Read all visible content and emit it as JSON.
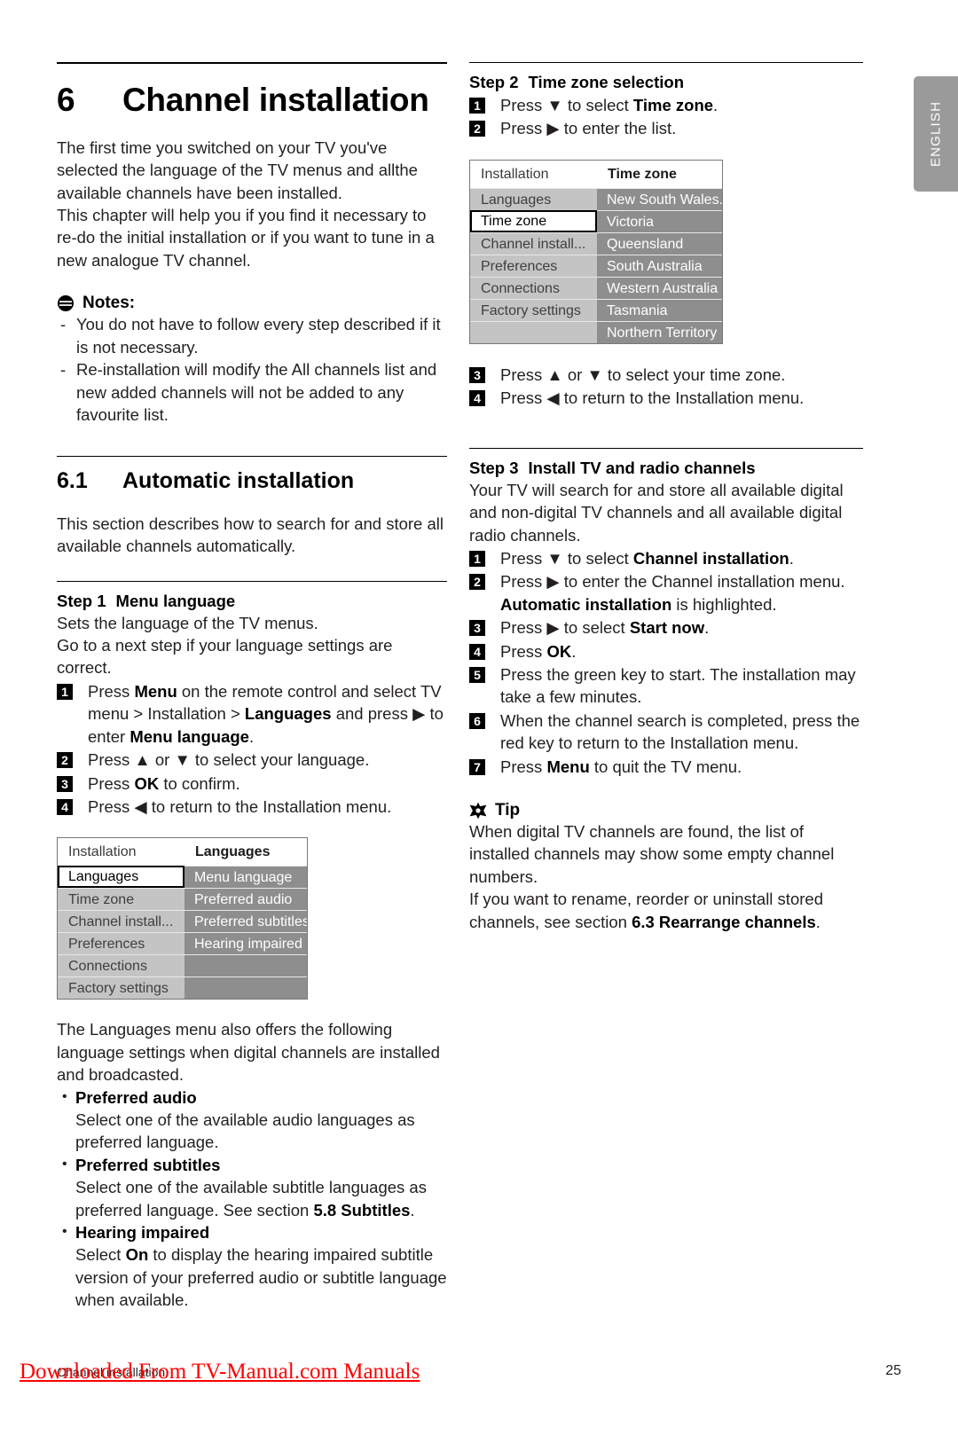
{
  "side_tab": {
    "label": "ENGLISH"
  },
  "left": {
    "chapter": {
      "number": "6",
      "title": "Channel installation"
    },
    "intro": [
      "The first time you switched on your TV you've selected the language of the TV menus and allthe available channels have been installed.",
      "This chapter will help you if you find it necessary to re-do the initial installation or if you want to tune in a new analogue TV channel."
    ],
    "notes_heading": "Notes:",
    "notes": [
      "You do not have to follow every step described if it is not necessary.",
      "Re-installation will modify the All channels list and new added channels will not be added to any favourite list."
    ],
    "section": {
      "number": "6.1",
      "title": "Automatic installation"
    },
    "section_intro": "This section describes how to search for and store all available channels automatically.",
    "step1": {
      "label": "Step 1",
      "title": "Menu language",
      "lines": [
        "Sets the language of the TV menus.",
        "Go to a next step if your language settings are correct."
      ],
      "steps": [
        {
          "num": "1",
          "parts": [
            {
              "t": "Press ",
              "b": false
            },
            {
              "t": "Menu",
              "b": true
            },
            {
              "t": " on the remote control and select TV menu > Installation > ",
              "b": false
            },
            {
              "t": "Languages",
              "b": true
            },
            {
              "t": " and press ",
              "b": false
            },
            {
              "t": "▶",
              "b": false
            },
            {
              "t": " to enter ",
              "b": false
            },
            {
              "t": "Menu language",
              "b": true
            },
            {
              "t": ".",
              "b": false
            }
          ]
        },
        {
          "num": "2",
          "parts": [
            {
              "t": "Press ▲ or ▼ to select your language.",
              "b": false
            }
          ]
        },
        {
          "num": "3",
          "parts": [
            {
              "t": "Press ",
              "b": false
            },
            {
              "t": "OK",
              "b": true
            },
            {
              "t": " to confirm.",
              "b": false
            }
          ]
        },
        {
          "num": "4",
          "parts": [
            {
              "t": "Press ◀ to return to the Installation menu.",
              "b": false
            }
          ]
        }
      ]
    },
    "languages_menu": {
      "head_left": "Installation",
      "head_right": "Languages",
      "rows": [
        {
          "left": "Languages",
          "right": "Menu language",
          "selected": true
        },
        {
          "left": "Time zone",
          "right": "Preferred audio",
          "selected": false
        },
        {
          "left": "Channel install...",
          "right": "Preferred subtitles",
          "selected": false
        },
        {
          "left": "Preferences",
          "right": "Hearing impaired",
          "selected": false
        },
        {
          "left": "Connections",
          "right": "",
          "selected": false
        },
        {
          "left": "Factory settings",
          "right": "",
          "selected": false
        }
      ]
    },
    "languages_note": "The Languages menu also offers the following language settings when digital channels are installed and broadcasted.",
    "lang_bullets": [
      {
        "title": "Preferred audio",
        "desc_parts": [
          {
            "t": "Select one of the available audio languages as preferred language.",
            "b": false
          }
        ]
      },
      {
        "title": "Preferred subtitles",
        "desc_parts": [
          {
            "t": "Select one of the available subtitle languages as preferred language. See section ",
            "b": false
          },
          {
            "t": "5.8 Subtitles",
            "b": true
          },
          {
            "t": ".",
            "b": false
          }
        ]
      },
      {
        "title": "Hearing impaired",
        "desc_parts": [
          {
            "t": "Select ",
            "b": false
          },
          {
            "t": "On",
            "b": true
          },
          {
            "t": " to display the hearing impaired subtitle version of your preferred audio or subtitle language when available.",
            "b": false
          }
        ]
      }
    ]
  },
  "right": {
    "step2": {
      "label": "Step 2",
      "title": "Time zone selection",
      "steps": [
        {
          "num": "1",
          "parts": [
            {
              "t": "Press ▼ to select ",
              "b": false
            },
            {
              "t": "Time zone",
              "b": true
            },
            {
              "t": ".",
              "b": false
            }
          ]
        },
        {
          "num": "2",
          "parts": [
            {
              "t": "Press ▶ to enter the list.",
              "b": false
            }
          ]
        }
      ],
      "steps_after": [
        {
          "num": "3",
          "parts": [
            {
              "t": "Press ▲ or ▼ to select your time zone.",
              "b": false
            }
          ]
        },
        {
          "num": "4",
          "parts": [
            {
              "t": "Press ◀ to return to the Installation menu.",
              "b": false
            }
          ]
        }
      ]
    },
    "timezone_menu": {
      "head_left": "Installation",
      "head_right": "Time zone",
      "rows": [
        {
          "left": "Languages",
          "right": "New South Wales...",
          "selected": false
        },
        {
          "left": "Time zone",
          "right": "Victoria",
          "selected": true
        },
        {
          "left": "Channel install...",
          "right": "Queensland",
          "selected": false
        },
        {
          "left": "Preferences",
          "right": "South Australia",
          "selected": false
        },
        {
          "left": "Connections",
          "right": "Western Australia",
          "selected": false
        },
        {
          "left": "Factory settings",
          "right": "Tasmania",
          "selected": false
        },
        {
          "left": "",
          "right": "Northern Territory",
          "selected": false
        }
      ]
    },
    "step3": {
      "label": "Step 3",
      "title": "Install TV and radio channels",
      "intro": "Your TV will search for and store all available digital and non-digital TV channels and all available digital radio channels.",
      "steps": [
        {
          "num": "1",
          "parts": [
            {
              "t": "Press ▼ to select ",
              "b": false
            },
            {
              "t": "Channel installation",
              "b": true
            },
            {
              "t": ".",
              "b": false
            }
          ]
        },
        {
          "num": "2",
          "parts": [
            {
              "t": "Press ▶ to enter the Channel installation menu. ",
              "b": false
            },
            {
              "t": "Automatic installation",
              "b": true
            },
            {
              "t": " is highlighted.",
              "b": false
            }
          ]
        },
        {
          "num": "3",
          "parts": [
            {
              "t": "Press ▶ to select ",
              "b": false
            },
            {
              "t": "Start now",
              "b": true
            },
            {
              "t": ".",
              "b": false
            }
          ]
        },
        {
          "num": "4",
          "parts": [
            {
              "t": "Press ",
              "b": false
            },
            {
              "t": "OK",
              "b": true
            },
            {
              "t": ".",
              "b": false
            }
          ]
        },
        {
          "num": "5",
          "parts": [
            {
              "t": "Press the green key to start. The installation may take a few minutes.",
              "b": false
            }
          ]
        },
        {
          "num": "6",
          "parts": [
            {
              "t": "When the channel search is completed, press the red key to return to the Installation menu.",
              "b": false
            }
          ]
        },
        {
          "num": "7",
          "parts": [
            {
              "t": "Press ",
              "b": false
            },
            {
              "t": "Menu",
              "b": true
            },
            {
              "t": " to quit the TV menu.",
              "b": false
            }
          ]
        }
      ]
    },
    "tip_heading": "Tip",
    "tip_paragraphs": [
      [
        {
          "t": "When digital TV channels are found, the list of installed channels may show some empty channel numbers.",
          "b": false
        }
      ],
      [
        {
          "t": "If you want to rename, reorder or uninstall stored channels, see section ",
          "b": false
        },
        {
          "t": "6.3 Rearrange channels",
          "b": true
        },
        {
          "t": ".",
          "b": false
        }
      ]
    ]
  },
  "footer": {
    "section_label": "Channel installation",
    "watermark": "Downloaded From TV-Manual.com Manuals",
    "page_number": "25"
  }
}
